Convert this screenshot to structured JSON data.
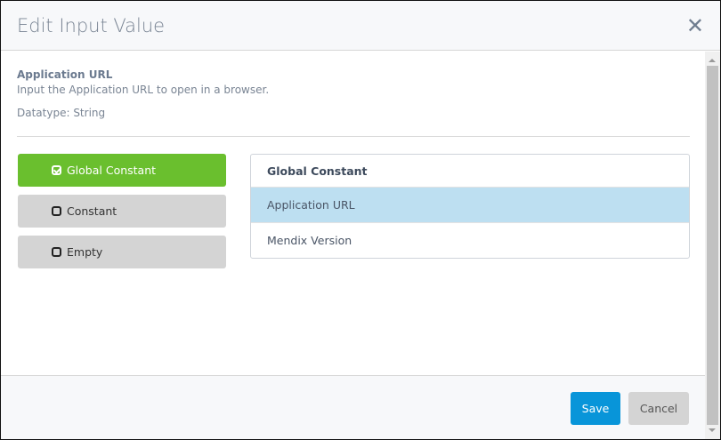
{
  "dialog": {
    "title": "Edit Input Value",
    "close_icon": "close-icon"
  },
  "input": {
    "name": "Application URL",
    "description": "Input the Application URL to open in a browser.",
    "datatype": "Datatype: String"
  },
  "options": [
    {
      "label": "Global Constant",
      "selected": true
    },
    {
      "label": "Constant",
      "selected": false
    },
    {
      "label": "Empty",
      "selected": false
    }
  ],
  "list": {
    "header": "Global Constant",
    "items": [
      {
        "label": "Application URL",
        "selected": true
      },
      {
        "label": "Mendix Version",
        "selected": false
      }
    ]
  },
  "footer": {
    "save": "Save",
    "cancel": "Cancel"
  },
  "colors": {
    "accent_green": "#6abf2e",
    "save_blue": "#0895d9",
    "selected_row": "#bddff1"
  }
}
